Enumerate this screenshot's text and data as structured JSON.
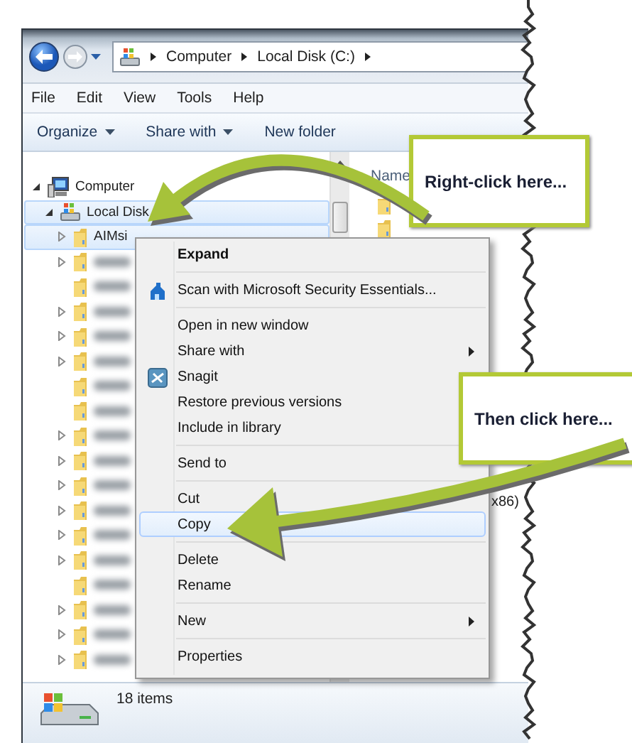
{
  "window": {
    "address_bar": {
      "crumbs": [
        "Computer",
        "Local Disk (C:)"
      ]
    },
    "menu_bar": [
      "File",
      "Edit",
      "View",
      "Tools",
      "Help"
    ],
    "toolbar": [
      {
        "label": "Organize",
        "dropdown": true
      },
      {
        "label": "Share with",
        "dropdown": true
      },
      {
        "label": "New folder",
        "dropdown": false
      }
    ],
    "navigation_tree": [
      {
        "kind": "computer",
        "label": "Computer",
        "expandable": true,
        "expanded": true,
        "selected": false,
        "children": [
          {
            "kind": "drive",
            "label": "Local Disk",
            "expandable": true,
            "expanded": true,
            "selected": true,
            "children": [
              {
                "kind": "folder",
                "label": "AIMsi",
                "expandable": true,
                "expanded": false,
                "selected": true
              },
              {
                "kind": "folder",
                "expandable": true,
                "expanded": false,
                "selected": false
              },
              {
                "kind": "folder",
                "expandable": false,
                "selected": false
              },
              {
                "kind": "folder",
                "expandable": true,
                "expanded": false,
                "selected": false
              },
              {
                "kind": "folder",
                "expandable": true,
                "expanded": false,
                "selected": false
              },
              {
                "kind": "folder",
                "expandable": true,
                "expanded": false,
                "selected": false
              },
              {
                "kind": "folder",
                "expandable": false,
                "selected": false
              },
              {
                "kind": "folder",
                "expandable": false,
                "selected": false
              },
              {
                "kind": "folder",
                "expandable": true,
                "expanded": false,
                "selected": false
              },
              {
                "kind": "folder",
                "expandable": true,
                "expanded": false,
                "selected": false
              },
              {
                "kind": "folder",
                "expandable": true,
                "expanded": false,
                "selected": false
              },
              {
                "kind": "folder",
                "expandable": true,
                "expanded": false,
                "selected": false
              },
              {
                "kind": "folder",
                "expandable": true,
                "expanded": false,
                "selected": false
              },
              {
                "kind": "folder",
                "expandable": true,
                "expanded": false,
                "selected": false
              },
              {
                "kind": "folder",
                "expandable": false,
                "selected": false
              },
              {
                "kind": "folder",
                "expandable": true,
                "expanded": false,
                "selected": false
              },
              {
                "kind": "folder",
                "expandable": true,
                "expanded": false,
                "selected": false
              },
              {
                "kind": "folder",
                "expandable": true,
                "expanded": false,
                "selected": false
              }
            ]
          }
        ]
      }
    ],
    "content": {
      "columns": [
        "Name"
      ],
      "visible_fragment": "x86)"
    },
    "status_bar": {
      "count": "18 items"
    }
  },
  "context_menu": [
    {
      "kind": "item",
      "label": "Expand",
      "default": true,
      "submenu": false,
      "selected": false
    },
    {
      "kind": "separator"
    },
    {
      "kind": "item",
      "label": "Scan with Microsoft Security Essentials...",
      "default": false,
      "submenu": false,
      "selected": false
    },
    {
      "kind": "separator"
    },
    {
      "kind": "item",
      "label": "Open in new window",
      "default": false,
      "submenu": false,
      "selected": false
    },
    {
      "kind": "item",
      "label": "Share with",
      "default": false,
      "submenu": true,
      "selected": false
    },
    {
      "kind": "item",
      "label": "Snagit",
      "default": false,
      "submenu": false,
      "selected": false
    },
    {
      "kind": "item",
      "label": "Restore previous versions",
      "default": false,
      "submenu": false,
      "selected": false
    },
    {
      "kind": "item",
      "label": "Include in library",
      "default": false,
      "submenu": false,
      "selected": false
    },
    {
      "kind": "separator"
    },
    {
      "kind": "item",
      "label": "Send to",
      "default": false,
      "submenu": false,
      "selected": false
    },
    {
      "kind": "separator"
    },
    {
      "kind": "item",
      "label": "Cut",
      "default": false,
      "submenu": false,
      "selected": false
    },
    {
      "kind": "item",
      "label": "Copy",
      "default": false,
      "submenu": false,
      "selected": true
    },
    {
      "kind": "separator"
    },
    {
      "kind": "item",
      "label": "Delete",
      "default": false,
      "submenu": false,
      "selected": false
    },
    {
      "kind": "item",
      "label": "Rename",
      "default": false,
      "submenu": false,
      "selected": false
    },
    {
      "kind": "separator"
    },
    {
      "kind": "item",
      "label": "New",
      "default": false,
      "submenu": true,
      "selected": false
    },
    {
      "kind": "separator"
    },
    {
      "kind": "item",
      "label": "Properties",
      "default": false,
      "submenu": false,
      "selected": false
    }
  ],
  "callouts": [
    {
      "text": "Right-click here..."
    },
    {
      "text": "Then click here..."
    }
  ]
}
